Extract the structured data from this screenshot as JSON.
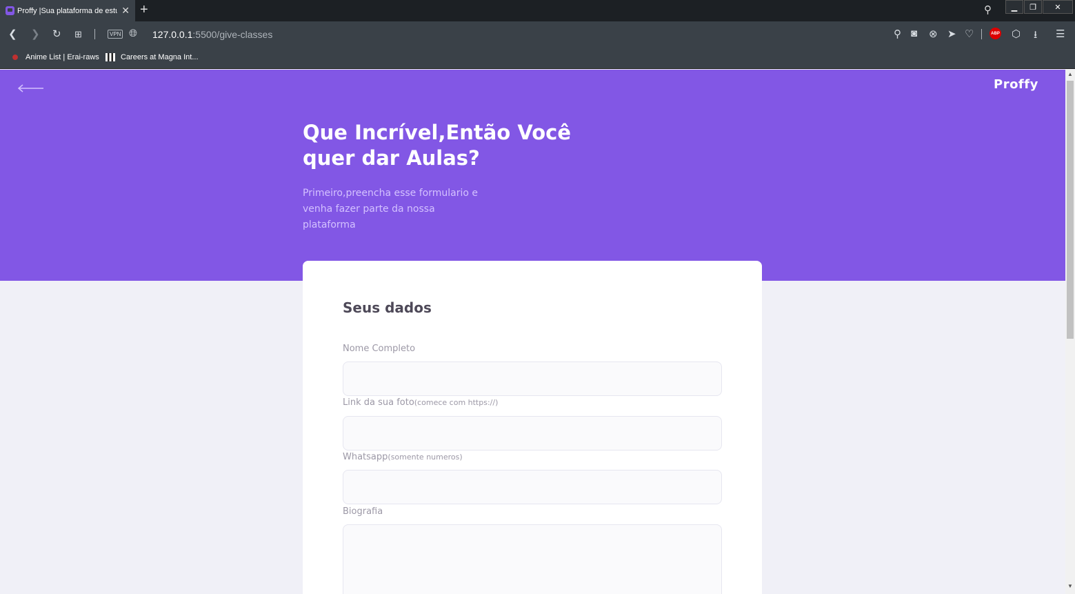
{
  "browser": {
    "tab_title": "Proffy |Sua plataforma de estudos",
    "url_host": "127.0.0.1",
    "url_path": ":5500/give-classes",
    "vpn_label": "VPN",
    "abp_label": "ABP",
    "bookmarks": [
      {
        "label": "Anime List | Erai-raws"
      },
      {
        "label": "Careers at Magna Int..."
      }
    ]
  },
  "header": {
    "logo": "Proffy",
    "title": "Que Incrível,Então Você quer dar Aulas?",
    "subtitle": "Primeiro,preencha esse formulario e venha fazer parte da nossa plataforma"
  },
  "form": {
    "section_title": "Seus dados",
    "fields": [
      {
        "label": "Nome Completo",
        "hint": ""
      },
      {
        "label": "Link da sua foto",
        "hint": "(comece com https://)"
      },
      {
        "label": "Whatsapp",
        "hint": "(somente numeros)"
      },
      {
        "label": "Biografia",
        "hint": ""
      }
    ]
  },
  "colors": {
    "primary": "#8257e5",
    "background": "#f0f0f7",
    "card": "#ffffff"
  }
}
